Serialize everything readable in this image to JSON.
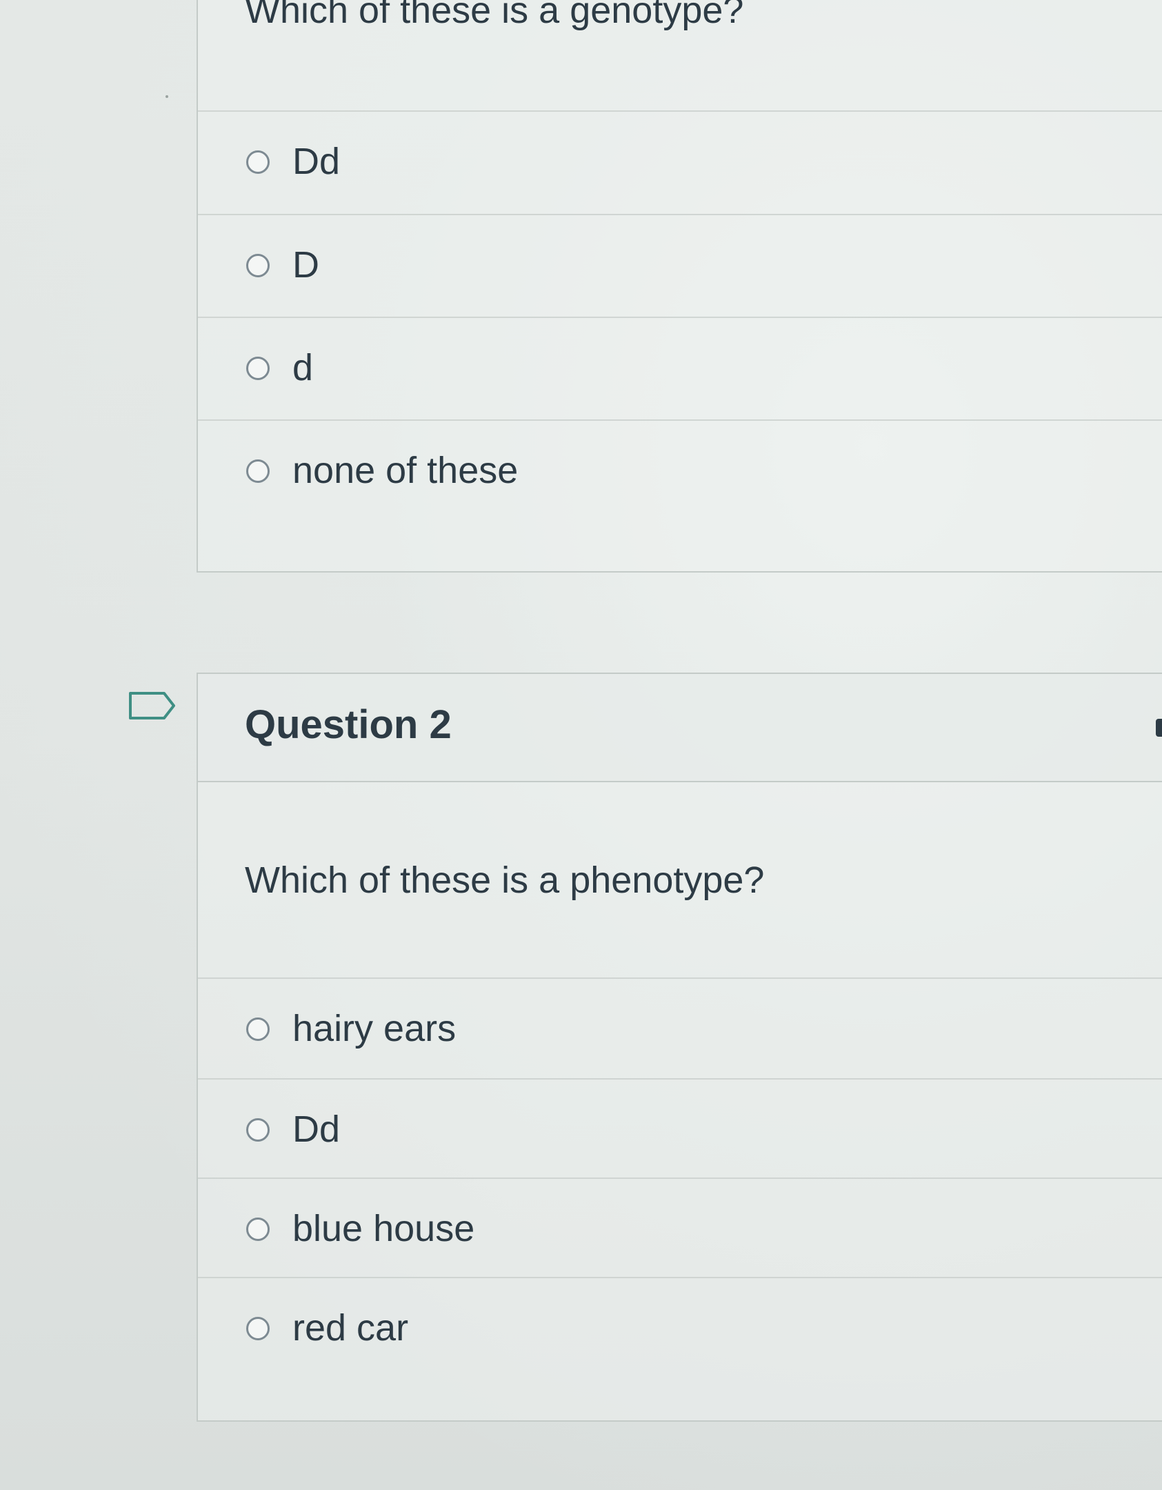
{
  "question1": {
    "text": "Which of these is a genotype?",
    "answers": [
      {
        "label": "Dd"
      },
      {
        "label": "D"
      },
      {
        "label": "d"
      },
      {
        "label": "none of these"
      }
    ]
  },
  "question2": {
    "heading": "Question 2",
    "text": "Which of these is a phenotype?",
    "answers": [
      {
        "label": "hairy ears"
      },
      {
        "label": "Dd"
      },
      {
        "label": "blue house"
      },
      {
        "label": "red car"
      }
    ]
  },
  "icons": {
    "flag": "flag-question-icon"
  },
  "colors": {
    "text": "#2d3b45",
    "border": "#c4cbc8",
    "radio": "#7d8a92",
    "background": "#e1e5e3"
  }
}
